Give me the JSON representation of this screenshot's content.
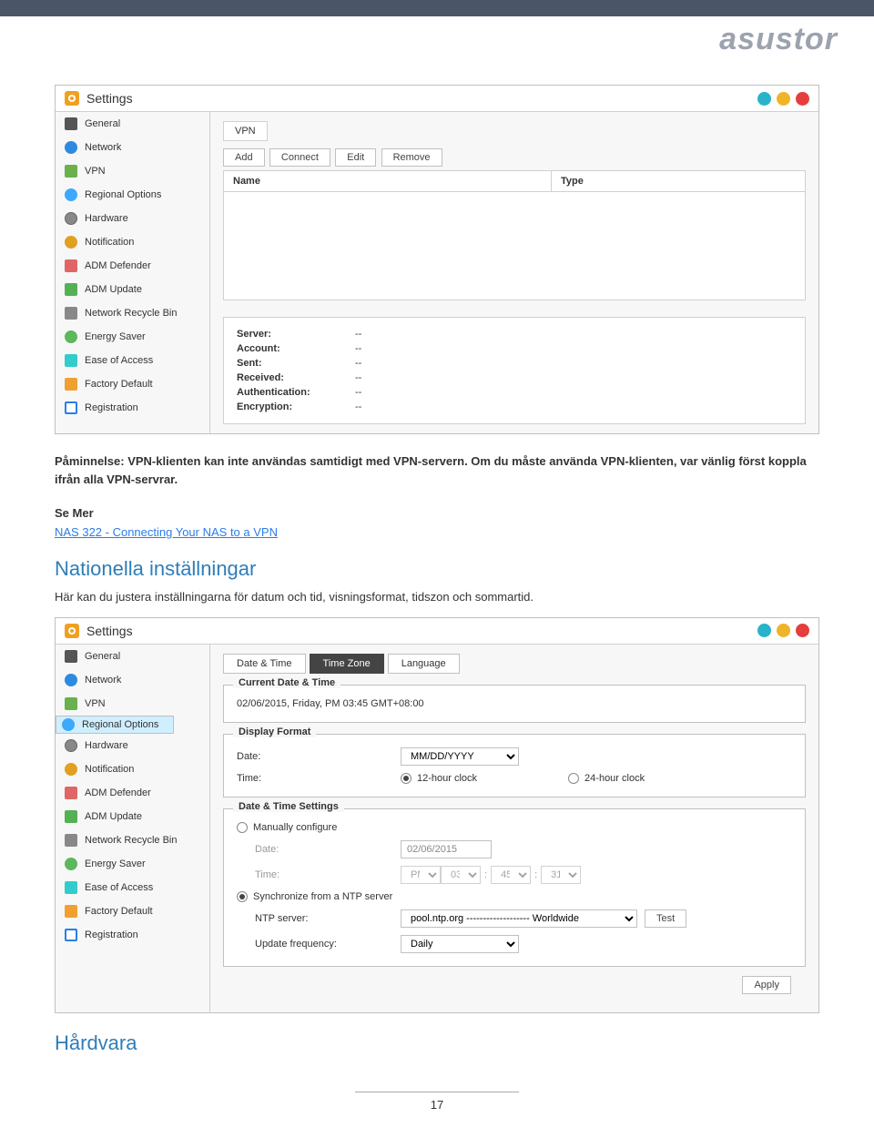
{
  "brand": "asustor",
  "window_title": "Settings",
  "sidebar": {
    "items": [
      {
        "label": "General"
      },
      {
        "label": "Network"
      },
      {
        "label": "VPN"
      },
      {
        "label": "Regional Options"
      },
      {
        "label": "Hardware"
      },
      {
        "label": "Notification"
      },
      {
        "label": "ADM Defender"
      },
      {
        "label": "ADM Update"
      },
      {
        "label": "Network Recycle Bin"
      },
      {
        "label": "Energy Saver"
      },
      {
        "label": "Ease of Access"
      },
      {
        "label": "Factory Default"
      },
      {
        "label": "Registration"
      }
    ]
  },
  "vpn": {
    "tab": "VPN",
    "toolbar": {
      "add": "Add",
      "connect": "Connect",
      "edit": "Edit",
      "remove": "Remove"
    },
    "cols": {
      "name": "Name",
      "type": "Type"
    },
    "info": {
      "server_l": "Server:",
      "server_v": "--",
      "account_l": "Account:",
      "account_v": "--",
      "sent_l": "Sent:",
      "sent_v": "--",
      "received_l": "Received:",
      "received_v": "--",
      "auth_l": "Authentication:",
      "auth_v": "--",
      "enc_l": "Encryption:",
      "enc_v": "--"
    }
  },
  "body1": "Påminnelse: VPN-klienten kan inte användas samtidigt med VPN-servern. Om du måste använda VPN-klienten, var vänlig först koppla ifrån alla VPN-servrar.",
  "seemore": "Se Mer",
  "link": "NAS 322 - Connecting Your NAS to a VPN",
  "section2_title": "Nationella inställningar",
  "section2_body": "Här kan du justera inställningarna för datum och tid, visningsformat, tidszon och sommartid.",
  "dt": {
    "tabs": {
      "dt": "Date & Time",
      "tz": "Time Zone",
      "lang": "Language"
    },
    "fs_current": "Current Date & Time",
    "current_value": "02/06/2015, Friday, PM 03:45 GMT+08:00",
    "fs_format": "Display Format",
    "date_l": "Date:",
    "date_v": "MM/DD/YYYY",
    "time_l": "Time:",
    "h12": "12-hour clock",
    "h24": "24-hour clock",
    "fs_settings": "Date & Time Settings",
    "manual": "Manually configure",
    "m_date_l": "Date:",
    "m_date_v": "02/06/2015",
    "m_time_l": "Time:",
    "pm": "PM",
    "hh": "03",
    "mm": "45",
    "ss": "31",
    "sync": "Synchronize from a NTP server",
    "ntp_l": "NTP server:",
    "ntp_v": "pool.ntp.org ------------------- Worldwide",
    "test": "Test",
    "freq_l": "Update frequency:",
    "freq_v": "Daily",
    "apply": "Apply"
  },
  "section3_title": "Hårdvara",
  "pagenum": "17"
}
